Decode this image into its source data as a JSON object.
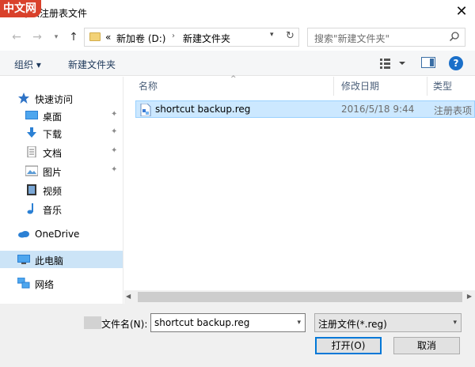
{
  "window": {
    "title": "导入注册表文件",
    "watermark": "中文网",
    "close_glyph": "✕"
  },
  "nav": {
    "back_glyph": "←",
    "forward_glyph": "→",
    "recent_glyph": "▾",
    "up_glyph": "↑",
    "crumb_overflow": "«",
    "crumbs": [
      "新加卷 (D:)",
      "新建文件夹"
    ],
    "crumb_sep": "›",
    "address_dropdown_glyph": "▾",
    "refresh_glyph": "↻",
    "search_placeholder": "搜索\"新建文件夹\""
  },
  "toolbar": {
    "organize_label": "组织 ▾",
    "new_folder_label": "新建文件夹",
    "help_label": "?"
  },
  "sidebar": {
    "pin_glyph": "✦",
    "items": [
      {
        "label": "快速访问",
        "icon": "star-icon"
      },
      {
        "label": "桌面",
        "icon": "desktop-icon",
        "pinned": true
      },
      {
        "label": "下载",
        "icon": "download-icon",
        "pinned": true
      },
      {
        "label": "文档",
        "icon": "document-icon",
        "pinned": true
      },
      {
        "label": "图片",
        "icon": "picture-icon",
        "pinned": true
      },
      {
        "label": "视频",
        "icon": "video-icon"
      },
      {
        "label": "音乐",
        "icon": "music-icon"
      },
      {
        "label": "OneDrive",
        "icon": "cloud-icon"
      },
      {
        "label": "此电脑",
        "icon": "computer-icon",
        "selected": true
      },
      {
        "label": "网络",
        "icon": "network-icon"
      }
    ]
  },
  "filelist": {
    "sort_glyph": "^",
    "columns": [
      "名称",
      "修改日期",
      "类型"
    ],
    "rows": [
      {
        "name": "shortcut backup.reg",
        "date": "2016/5/18 9:44",
        "type": "注册表项"
      }
    ]
  },
  "scrollbar": {
    "left_glyph": "◀",
    "right_glyph": "▶"
  },
  "bottom": {
    "filename_label": "文件名(N):",
    "filename_value": "shortcut backup.reg",
    "dropdown_glyph": "▾",
    "filetype_value": "注册文件(*.reg)",
    "open_label": "打开(O)",
    "cancel_label": "取消"
  },
  "colors": {
    "selection": "#cce8ff",
    "selection_border": "#99d1ff",
    "sidebar_selected": "#cce4f7",
    "accent": "#0078d7",
    "folder": "#f3d277"
  }
}
